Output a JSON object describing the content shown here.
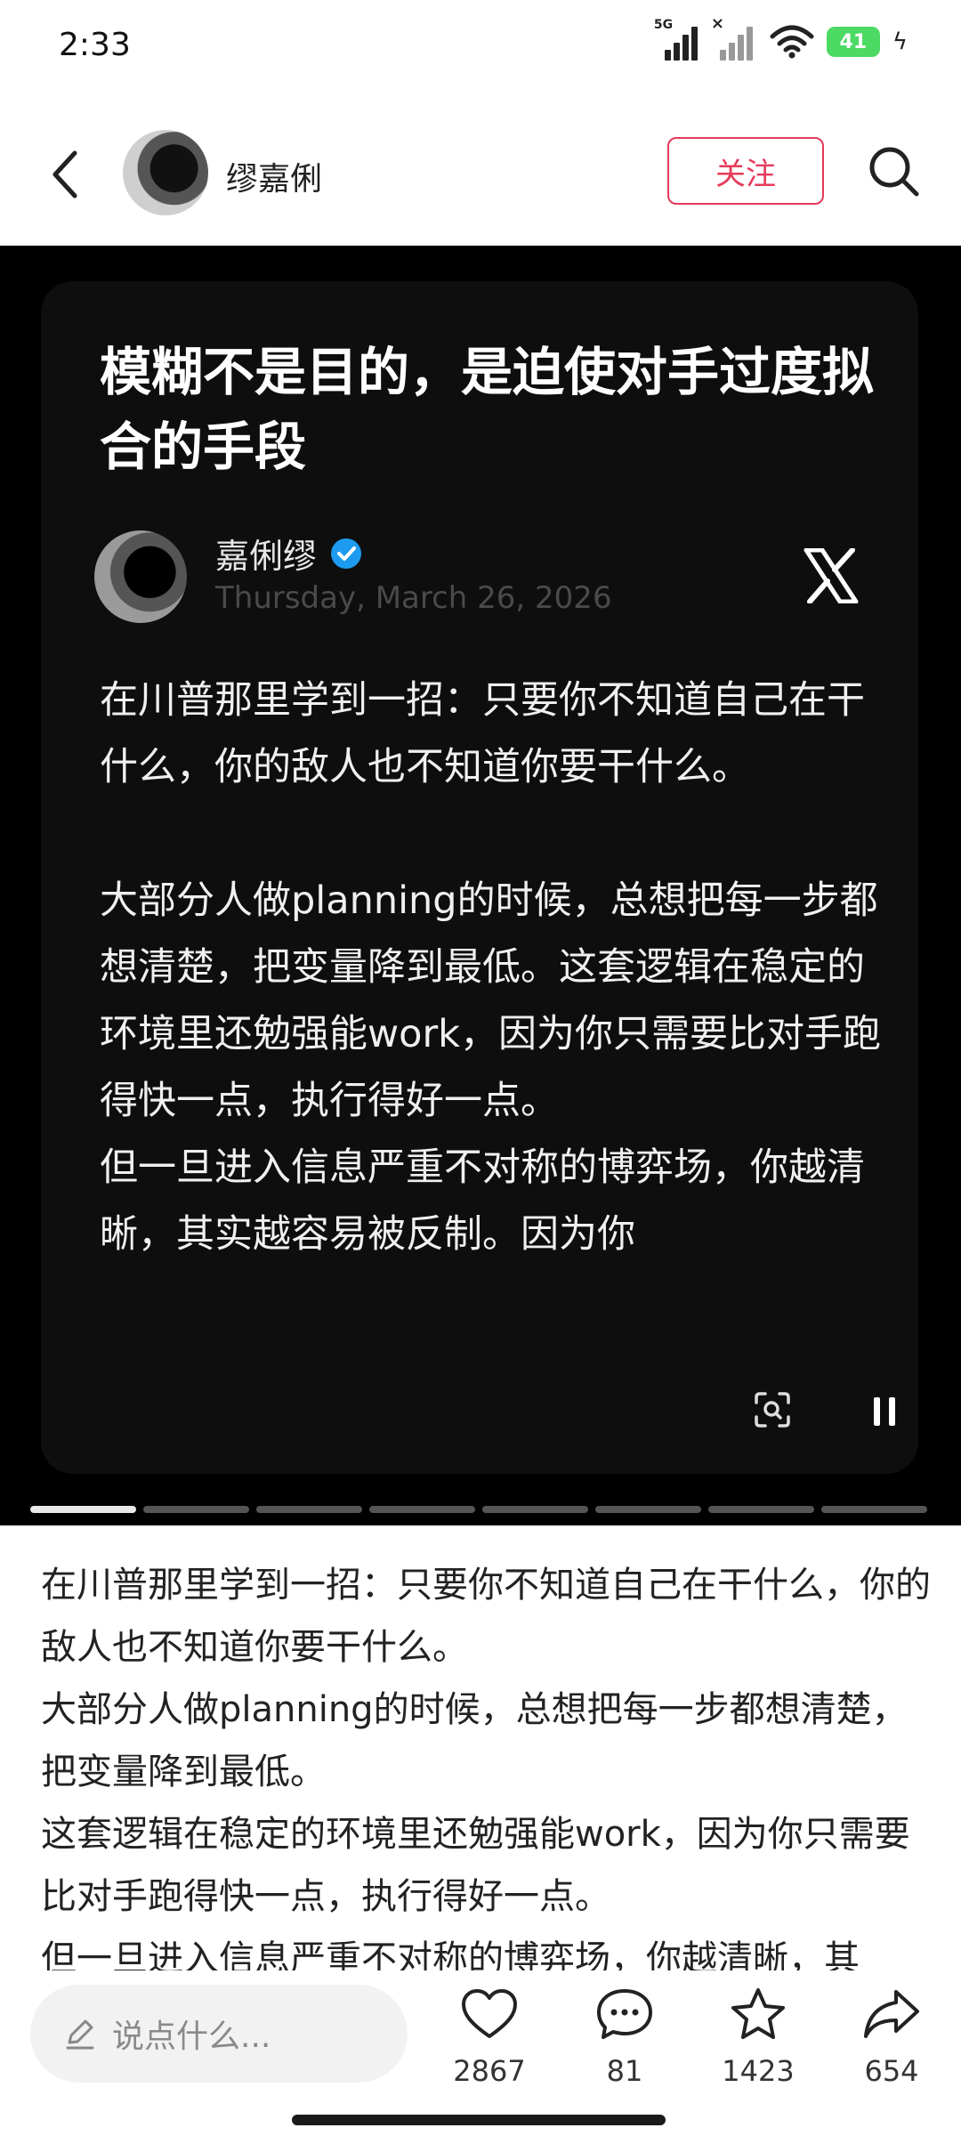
{
  "status_bar": {
    "time": "2:33",
    "network_label": "5G",
    "battery": "41"
  },
  "header": {
    "author_name": "缪嘉俐",
    "follow_label": "关注"
  },
  "card": {
    "title": "模糊不是目的，是迫使对手过度拟合的手段",
    "tweet_author": "嘉俐缪",
    "tweet_date": "Thursday, March 26, 2026",
    "paragraphs": [
      "在川普那里学到一招：只要你不知道自己在干什么，你的敌人也不知道你要干什么。",
      "大部分人做planning的时候，总想把每一步都想清楚，把变量降到最低。这套逻辑在稳定的环境里还勉强能work，因为你只需要比对手跑得快一点，执行得好一点。",
      "但一旦进入信息严重不对称的博弈场，你越清晰，其实越容易被反制。因为你"
    ],
    "page_count": 8,
    "active_page": 1
  },
  "description": {
    "lines": [
      "在川普那里学到一招：只要你不知道自己在干什么，你的敌人也不知道你要干什么。",
      "大部分人做planning的时候，总想把每一步都想清楚，把变量降到最低。",
      "这套逻辑在稳定的环境里还勉强能work，因为你只需要比对手跑得快一点，执行得好一点。",
      "但一旦进入信息严重不对称的博弈场，你越清晰，其"
    ]
  },
  "bottom_bar": {
    "comment_placeholder": "说点什么...",
    "likes": "2867",
    "comments": "81",
    "favorites": "1423",
    "shares": "654"
  },
  "colors": {
    "accent": "#e63a5a",
    "verified": "#1d9bf0",
    "battery": "#4cd964"
  }
}
